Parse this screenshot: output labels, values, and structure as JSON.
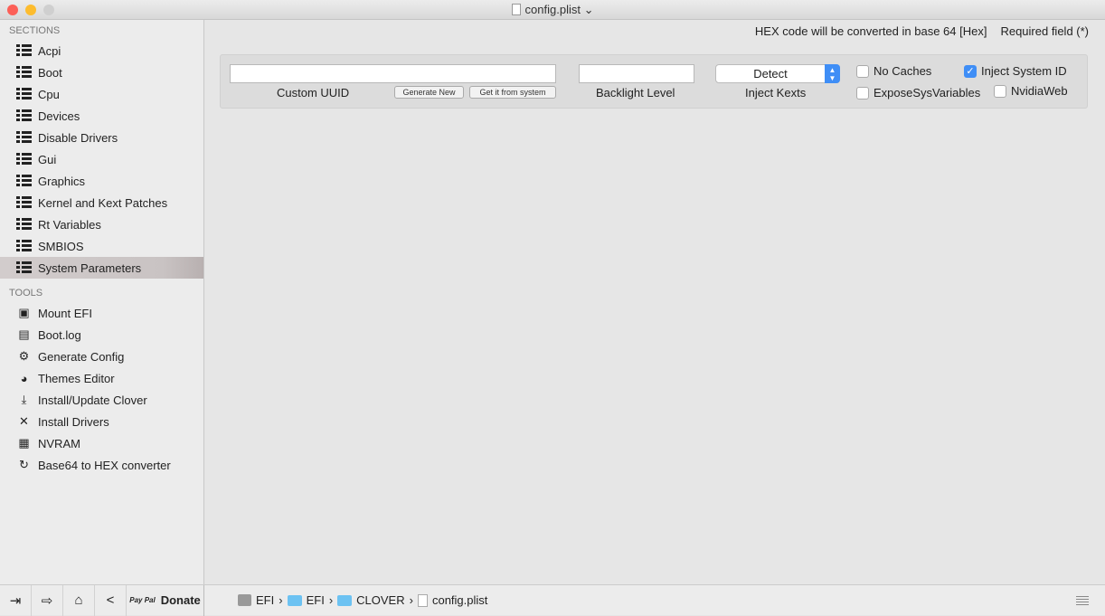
{
  "window": {
    "title": "config.plist"
  },
  "sidebar": {
    "sections_header": "SECTIONS",
    "sections": [
      "Acpi",
      "Boot",
      "Cpu",
      "Devices",
      "Disable Drivers",
      "Gui",
      "Graphics",
      "Kernel and Kext Patches",
      "Rt Variables",
      "SMBIOS",
      "System Parameters"
    ],
    "selected": "System Parameters",
    "tools_header": "TOOLS",
    "tools": [
      {
        "label": "Mount EFI",
        "icon": "disk-icon"
      },
      {
        "label": "Boot.log",
        "icon": "log-icon"
      },
      {
        "label": "Generate Config",
        "icon": "gears-icon"
      },
      {
        "label": "Themes Editor",
        "icon": "palette-icon"
      },
      {
        "label": "Install/Update Clover",
        "icon": "download-icon"
      },
      {
        "label": "Install Drivers",
        "icon": "tools-icon"
      },
      {
        "label": "NVRAM",
        "icon": "chip-icon"
      },
      {
        "label": "Base64 to HEX converter",
        "icon": "refresh-icon"
      }
    ]
  },
  "header": {
    "hex_note": "HEX code will be converted in base 64 [Hex]",
    "required_note": "Required field (*)"
  },
  "form": {
    "custom_uuid": {
      "label": "Custom UUID",
      "value": ""
    },
    "generate_new": "Generate New",
    "get_from_system": "Get it from system",
    "backlight_level": {
      "label": "Backlight Level",
      "value": ""
    },
    "inject_kexts": {
      "label": "Inject Kexts",
      "value": "Detect"
    },
    "no_caches": {
      "label": "No Caches",
      "checked": false
    },
    "inject_system_id": {
      "label": "Inject System ID",
      "checked": true
    },
    "expose_sys_variables": {
      "label": "ExposeSysVariables",
      "checked": false
    },
    "nvidia_web": {
      "label": "NvidiaWeb",
      "checked": false
    }
  },
  "bottombar": {
    "paypal": "Pay Pal",
    "donate": "Donate",
    "breadcrumb": [
      "EFI",
      "EFI",
      "CLOVER",
      "config.plist"
    ],
    "separator": "›"
  },
  "colors": {
    "accent": "#3f8ef6",
    "folder": "#6cc2f2"
  }
}
